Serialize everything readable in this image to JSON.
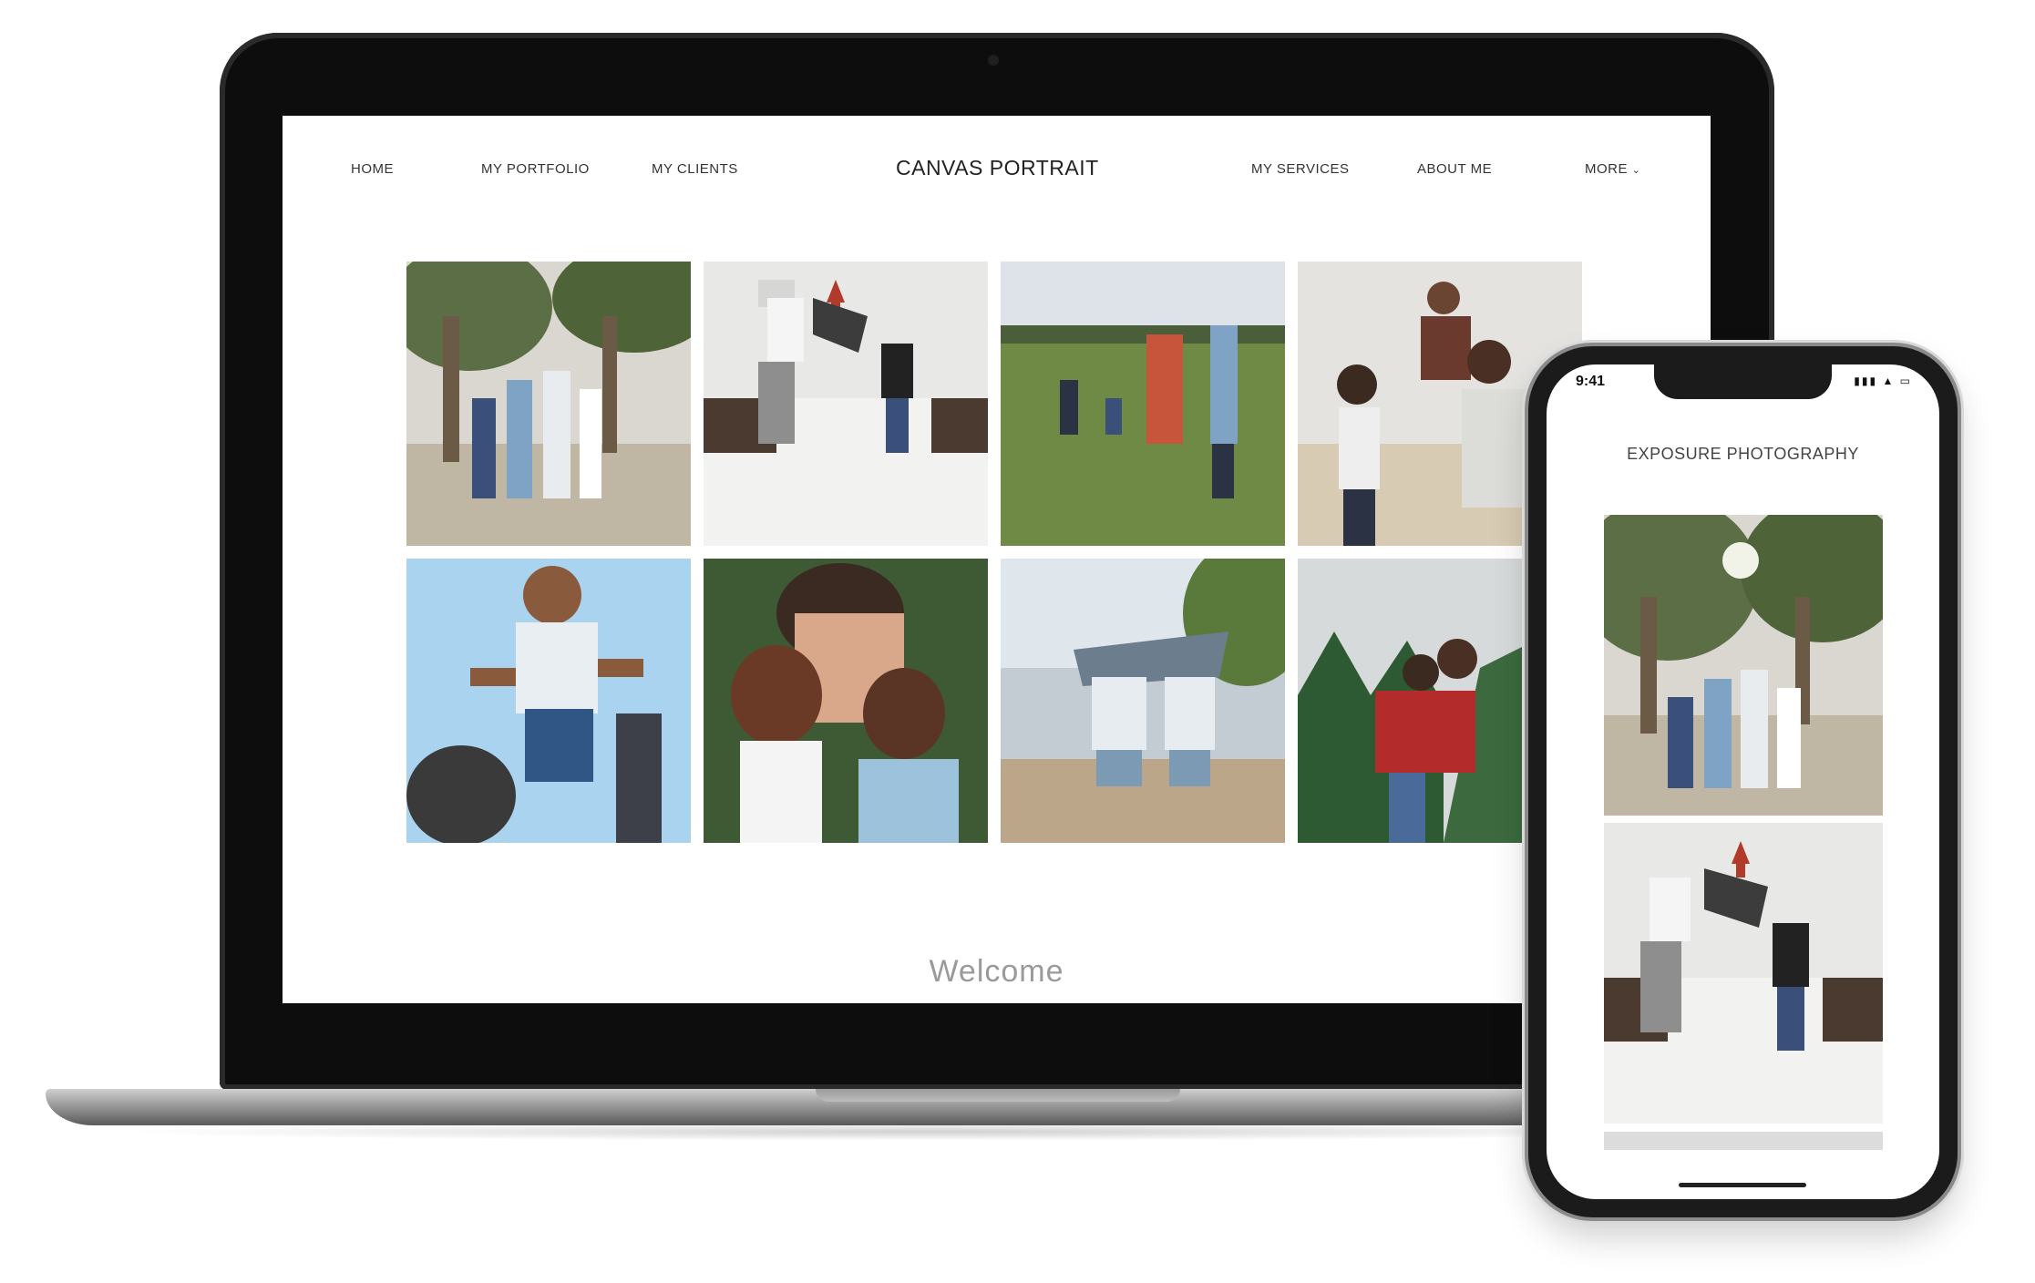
{
  "laptop_site": {
    "nav": {
      "home": "HOME",
      "portfolio": "MY PORTFOLIO",
      "clients": "MY CLIENTS",
      "title": "CANVAS PORTRAIT",
      "services": "MY SERVICES",
      "about": "ABOUT ME",
      "more": "MORE"
    },
    "welcome": "Welcome"
  },
  "phone_site": {
    "status_time": "9:41",
    "title": "EXPOSURE PHOTOGRAPHY"
  },
  "colors": {
    "device_frame": "#0d0d0d",
    "nav_text": "#333333",
    "welcome_text": "#9a9a9a"
  }
}
